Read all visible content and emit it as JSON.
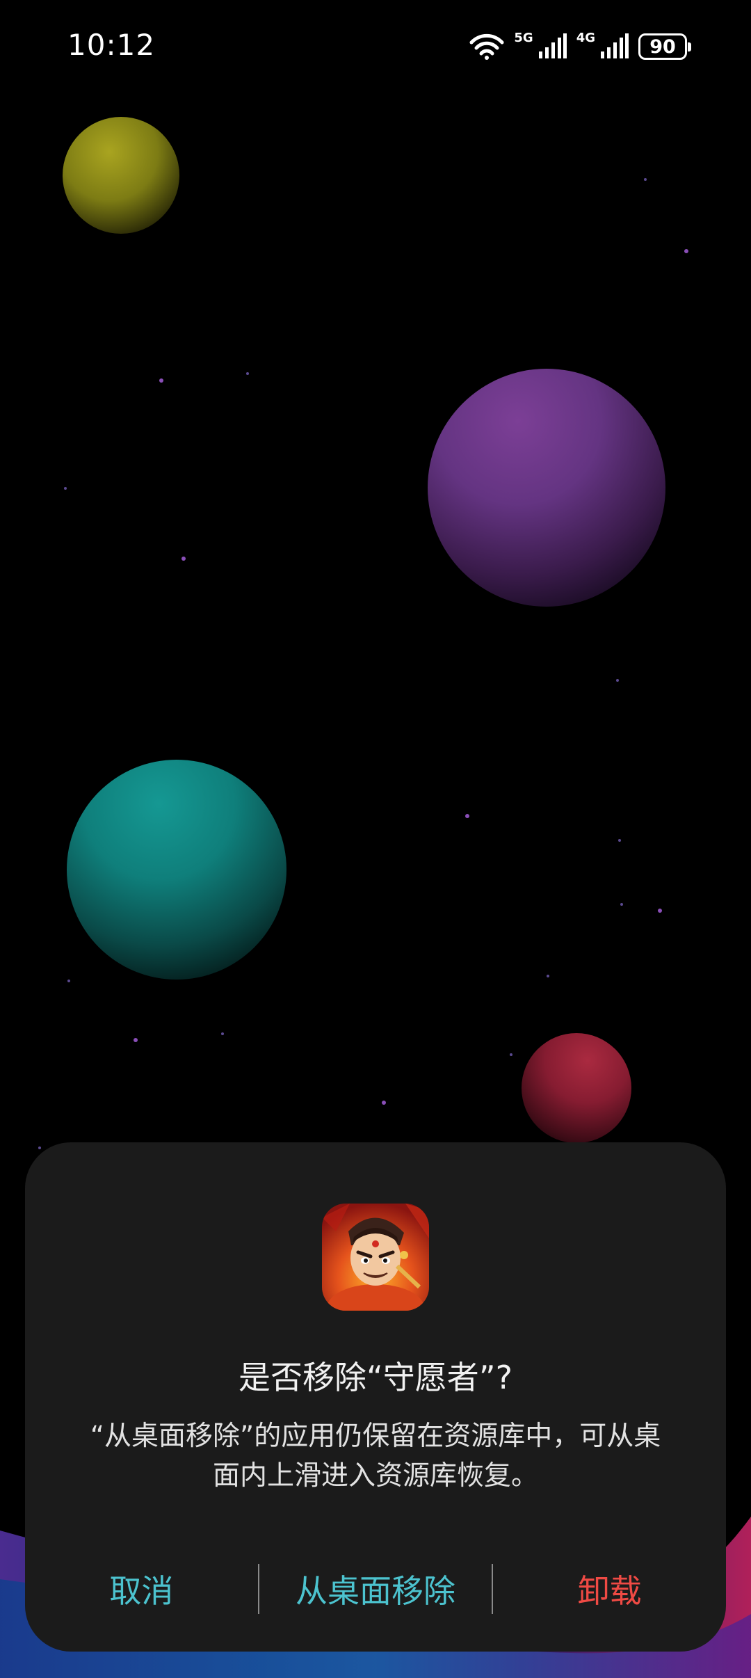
{
  "status_bar": {
    "time": "10:12",
    "network_5g_label": "5G",
    "network_4g_label": "4G",
    "battery_level": "90",
    "wifi_icon": "wifi-icon",
    "signal_icon": "cellular-signal-icon"
  },
  "wallpaper": {
    "planets": [
      "yellow",
      "purple",
      "teal",
      "red"
    ],
    "colors": {
      "yellow": "#a9a420",
      "purple": "#7c3f96",
      "teal": "#159893",
      "red": "#aa2a40"
    }
  },
  "dialog": {
    "app_icon": "app-icon-shouyuanzhe",
    "title": "是否移除“守愿者”?",
    "message": "“从桌面移除”的应用仍保留在资源库中，可从桌面内上滑进入资源库恢复。",
    "actions": {
      "cancel": "取消",
      "remove_from_desktop": "从桌面移除",
      "uninstall": "卸载"
    },
    "colors": {
      "background": "#1b1b1b",
      "accent": "#4cc3cf",
      "danger": "#ef4a44"
    }
  }
}
